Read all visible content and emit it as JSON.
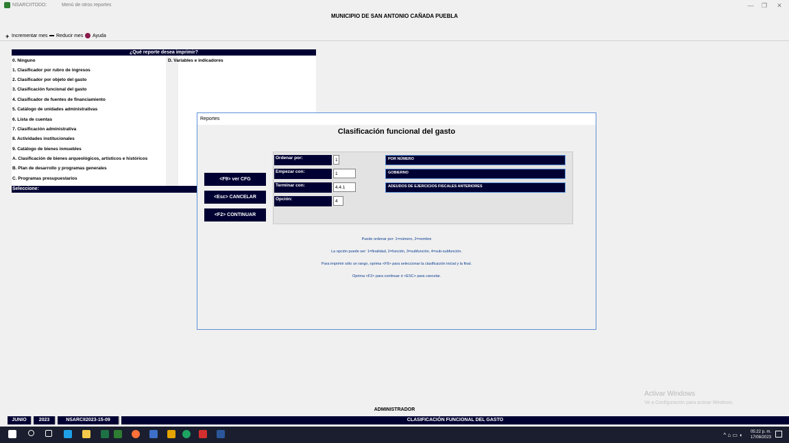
{
  "window": {
    "app_name": "NSARCIITODO:",
    "caption": "Menú de otros reportes",
    "minimize": "—",
    "restore": "❐",
    "close": "✕"
  },
  "header": {
    "title": "MUNICIPIO DE SAN ANTONIO CAÑADA PUEBLA"
  },
  "toolbar": {
    "increment_label": "Incrementar mes",
    "reduce_label": "Reducir mes",
    "help_label": "Ayuda"
  },
  "report_menu": {
    "header": "¿Qué reporte desea imprimir?",
    "items": [
      "0. Ninguno",
      "1. Clasificador por rubro de ingresos",
      "2. Clasificador por objeto del gasto",
      "3. Clasificación funcional del gasto",
      "4. Clasificador de fuentes de financiamiento",
      "5. Catálogo de unidades administrativas",
      "6. Lista de cuentas",
      "7. Clasificación administrativa",
      "8. Actividades institucionales",
      "9. Catálogo de bienes inmuebles",
      "A. Clasificación de bienes arqueológicos, artísticos e históricos",
      "B. Plan de desarrollo y programas generales",
      "C. Programas presupuestarios"
    ],
    "right_column": "D. Variables e indicadores",
    "select_label": "Seleccione:"
  },
  "dialog": {
    "title": "Reportes",
    "heading": "Clasificación funcional del gasto",
    "buttons": {
      "f9": "<F9> ver CFG",
      "esc": "<Esc> CANCELAR",
      "f2": "<F2> CONTINUAR"
    },
    "params": {
      "order_label": "Ordenar por:",
      "order_value": "1",
      "order_desc": "POR NÚMERO",
      "start_label": "Empezar con:",
      "start_value": "1",
      "start_desc": "GOBIERNO",
      "end_label": "Terminar con:",
      "end_value": "4.4.1",
      "end_desc": "ADEUDOS DE EJERCICIOS FISCALES ANTERIORES",
      "option_label": "Opción:",
      "option_value": "4"
    },
    "notes": [
      "Puede ordenar por: 1=número, 2=nombre",
      "La opción puede ser: 1=finalidad, 2=función, 3=subfunción, 4=sub-subfunción.",
      "Para imprimir sólo un rango, oprima <F9> para seleccionar la clasificación inicial y la final.",
      "Oprima <F2> para continuar ó <ESC> para cancelar."
    ]
  },
  "watermark": {
    "line1": "Activar Windows",
    "line2": "Ve a Configuración para activar Windows."
  },
  "status": {
    "user": "ADMINISTRADOR",
    "month": "JUNIO",
    "year": "2023",
    "db": "NSARCII2023-15-09",
    "report": "CLASIFICACIÓN FUNCIONAL DEL GASTO"
  },
  "taskbar": {
    "time": "05:22 p. m.",
    "date": "17/08/2023",
    "tray_icons": "^ ⌂ ▭ ◖"
  }
}
